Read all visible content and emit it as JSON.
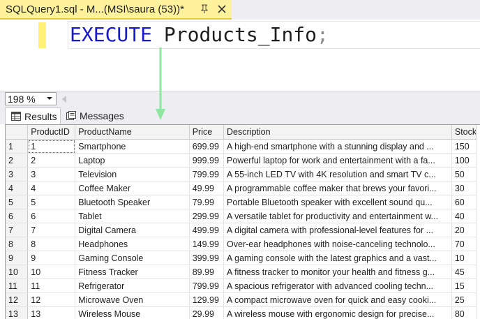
{
  "document_tab": {
    "title": "SQLQuery1.sql - M...(MSI\\saura (53))*"
  },
  "editor": {
    "keyword": "EXECUTE",
    "procedure_name": "Products_Info",
    "terminator": ";"
  },
  "zoom": {
    "value": "198 %"
  },
  "result_tabs": {
    "results_label": "Results",
    "messages_label": "Messages"
  },
  "grid": {
    "headers": [
      "ProductID",
      "ProductName",
      "Price",
      "Description",
      "Stock"
    ],
    "rows": [
      {
        "rownum": "1",
        "id": "1",
        "name": "Smartphone",
        "price": "699.99",
        "description": "A high-end smartphone with a stunning display and ...",
        "stock": "150"
      },
      {
        "rownum": "2",
        "id": "2",
        "name": "Laptop",
        "price": "999.99",
        "description": "Powerful laptop for work and entertainment with a fa...",
        "stock": "100"
      },
      {
        "rownum": "3",
        "id": "3",
        "name": "Television",
        "price": "799.99",
        "description": "A 55-inch LED TV with 4K resolution and smart TV c...",
        "stock": "50"
      },
      {
        "rownum": "4",
        "id": "4",
        "name": "Coffee Maker",
        "price": "49.99",
        "description": "A programmable coffee maker that brews your favori...",
        "stock": "30"
      },
      {
        "rownum": "5",
        "id": "5",
        "name": "Bluetooth Speaker",
        "price": "79.99",
        "description": "Portable Bluetooth speaker with excellent sound qu...",
        "stock": "60"
      },
      {
        "rownum": "6",
        "id": "6",
        "name": "Tablet",
        "price": "299.99",
        "description": "A versatile tablet for productivity and entertainment w...",
        "stock": "40"
      },
      {
        "rownum": "7",
        "id": "7",
        "name": "Digital Camera",
        "price": "499.99",
        "description": "A digital camera with professional-level features for ...",
        "stock": "20"
      },
      {
        "rownum": "8",
        "id": "8",
        "name": "Headphones",
        "price": "149.99",
        "description": "Over-ear headphones with noise-canceling technolo...",
        "stock": "70"
      },
      {
        "rownum": "9",
        "id": "9",
        "name": "Gaming Console",
        "price": "399.99",
        "description": "A gaming console with the latest graphics and a vast...",
        "stock": "10"
      },
      {
        "rownum": "10",
        "id": "10",
        "name": "Fitness Tracker",
        "price": "89.99",
        "description": "A fitness tracker to monitor your health and fitness g...",
        "stock": "45"
      },
      {
        "rownum": "11",
        "id": "11",
        "name": "Refrigerator",
        "price": "799.99",
        "description": "A spacious refrigerator with advanced cooling techn...",
        "stock": "15"
      },
      {
        "rownum": "12",
        "id": "12",
        "name": "Microwave Oven",
        "price": "129.99",
        "description": "A compact microwave oven for quick and easy cooki...",
        "stock": "25"
      },
      {
        "rownum": "13",
        "id": "13",
        "name": "Wireless Mouse",
        "price": "29.99",
        "description": "A wireless mouse with ergonomic design for precise...",
        "stock": "80"
      }
    ]
  },
  "colors": {
    "active_tab": "#fff29d",
    "keyword": "#1a1acc",
    "annotation_arrow": "#8fe6a0"
  },
  "icons": [
    "pin-icon",
    "close-icon",
    "chevron-down-icon",
    "scroll-left-icon",
    "grid-icon",
    "messages-icon",
    "arrow-down-icon"
  ]
}
